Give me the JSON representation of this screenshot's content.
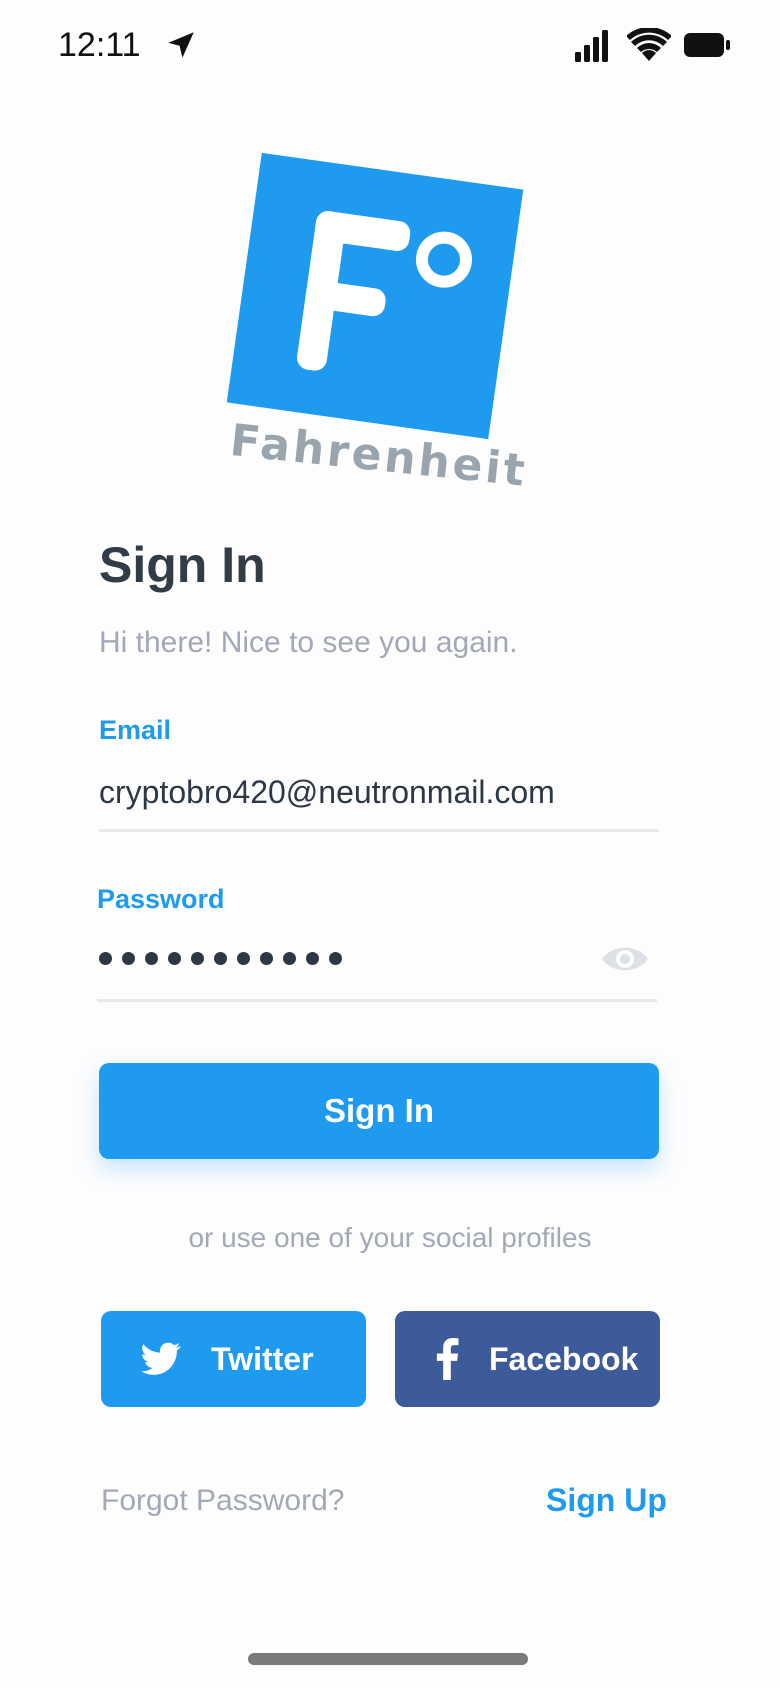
{
  "status_bar": {
    "time": "12:11",
    "icons": [
      "location-arrow-icon",
      "cellular-signal-icon",
      "wifi-icon",
      "battery-icon"
    ]
  },
  "logo": {
    "letter": "F°",
    "brand_name": "Fahrenheit",
    "color": "#1e9bee"
  },
  "header": {
    "title": "Sign In",
    "subtitle": "Hi there! Nice to see you again."
  },
  "form": {
    "email_label": "Email",
    "email_value": "cryptobro420@neutronmail.com",
    "password_label": "Password",
    "password_masked_count": 11,
    "password_toggle_icon": "eye-icon",
    "submit_label": "Sign In"
  },
  "social": {
    "prompt": "or use one of your social profiles",
    "twitter_label": "Twitter",
    "facebook_label": "Facebook",
    "twitter_color": "#1e9bee",
    "facebook_color": "#3d5a9a"
  },
  "footer": {
    "forgot_label": "Forgot Password?",
    "signup_label": "Sign Up"
  },
  "colors": {
    "accent": "#1e9bee",
    "text_dark": "#323c46",
    "text_muted": "#a2a8b5"
  }
}
